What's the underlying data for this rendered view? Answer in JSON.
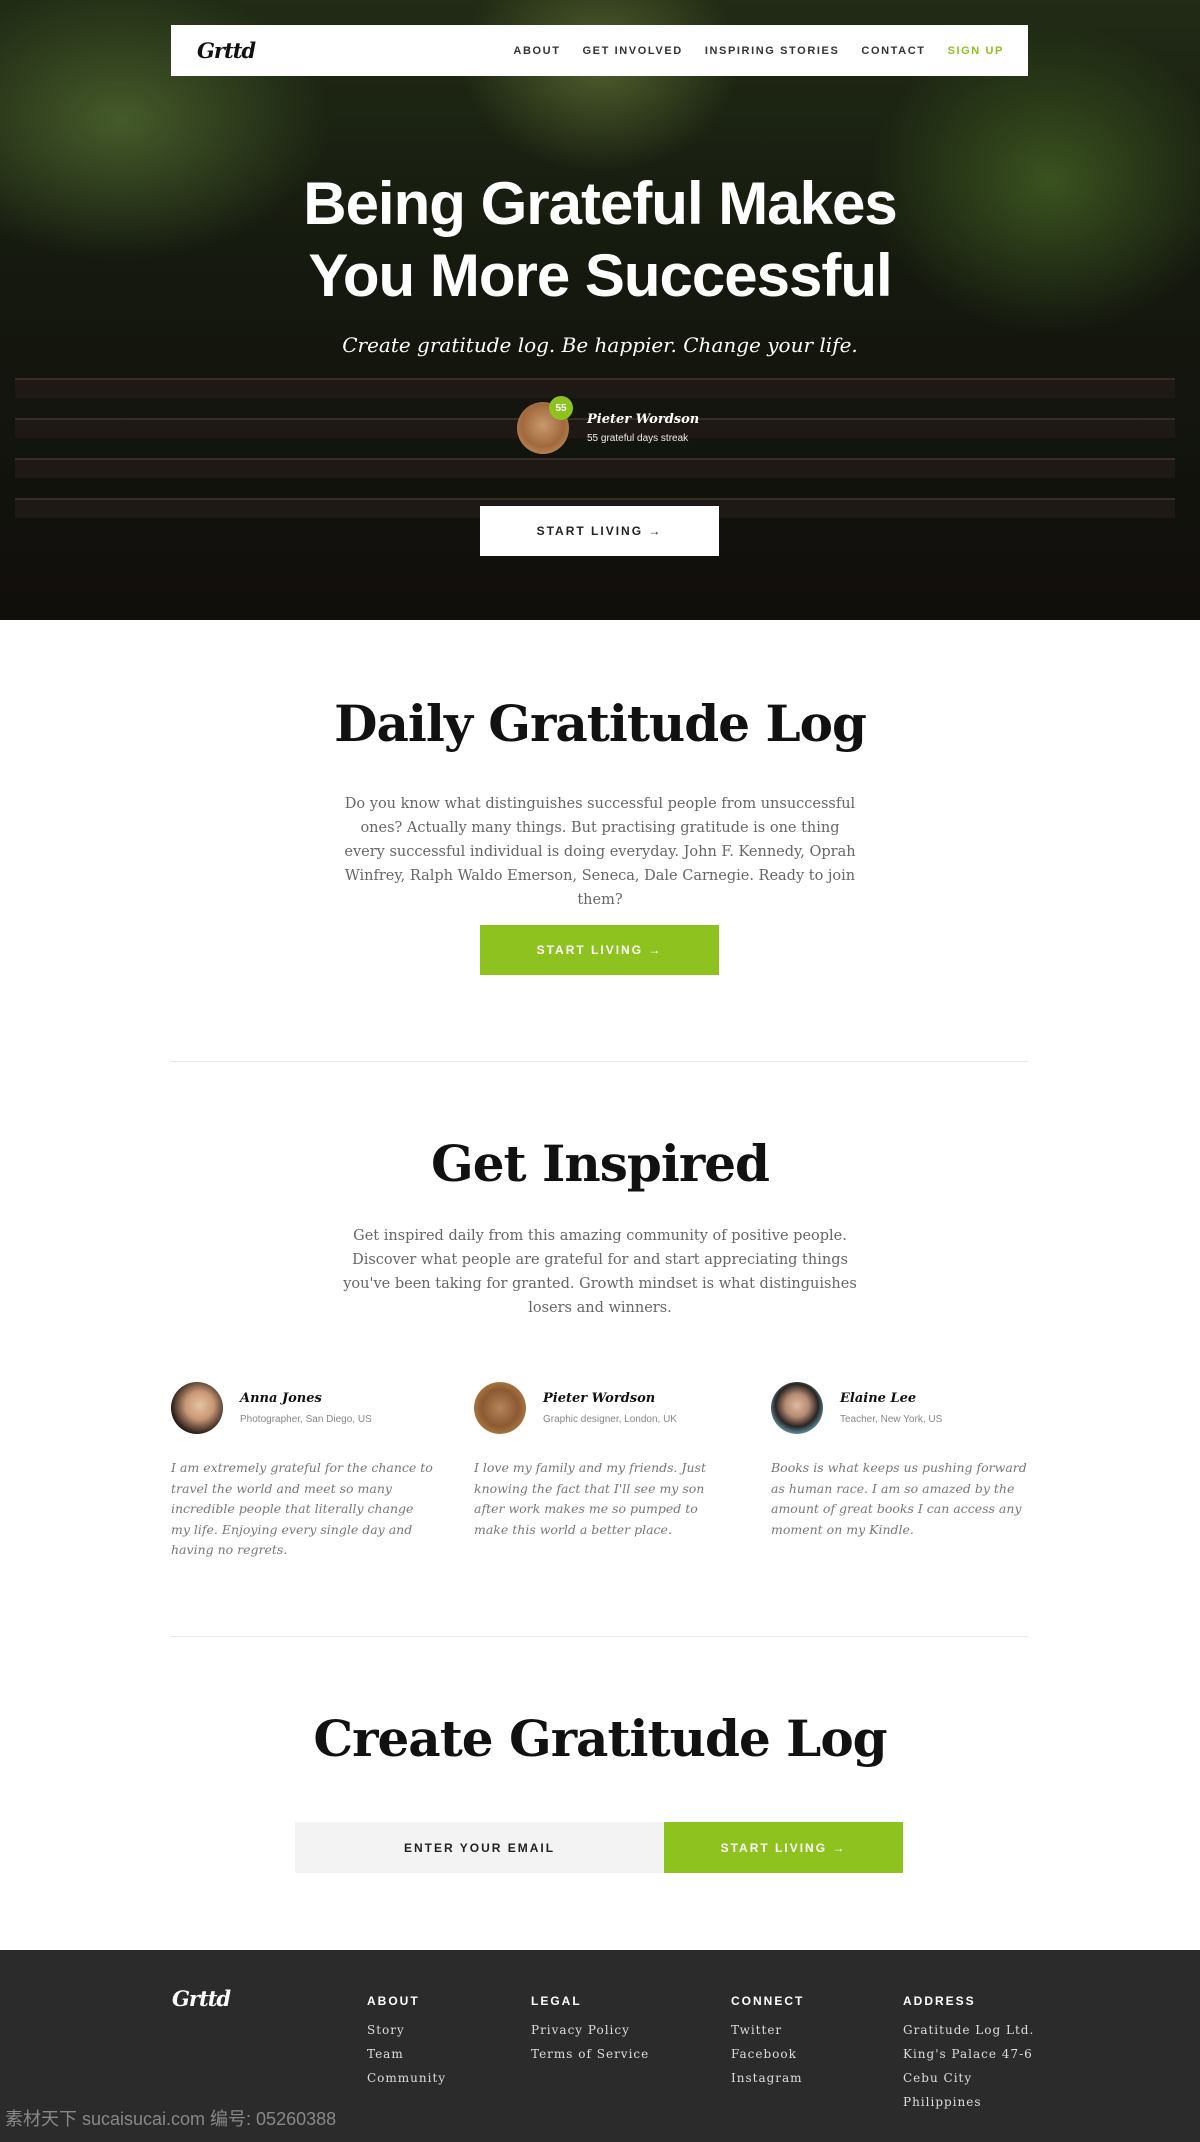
{
  "nav": {
    "logo": "Grttd",
    "links": [
      "ABOUT",
      "GET INVOLVED",
      "INSPIRING STORIES",
      "CONTACT"
    ],
    "signup": "SIGN UP"
  },
  "hero": {
    "title_line1": "Being Grateful Makes",
    "title_line2": "You More Successful",
    "subtitle": "Create gratitude log. Be happier. Change your life.",
    "user": {
      "name": "Pieter Wordson",
      "streak_badge": "55",
      "streak_text": "55 grateful days streak"
    },
    "cta": "START LIVING →"
  },
  "daily": {
    "title": "Daily Gratitude Log",
    "text": "Do you know what distinguishes successful people from unsuccessful ones? Actually many things. But practising gratitude is one thing every successful individual is doing everyday. John F. Kennedy, Oprah Winfrey, Ralph Waldo Emerson, Seneca, Dale Carnegie. Ready to join them?",
    "cta": "START LIVING →"
  },
  "inspired": {
    "title": "Get Inspired",
    "text": "Get inspired daily from this amazing community of positive people. Discover what people are grateful for and start appreciating things you've been taking for granted. Growth mindset is what distinguishes losers and winners.",
    "testimonials": [
      {
        "name": "Anna Jones",
        "role": "Photographer, San Diego, US",
        "quote": "I am extremely grateful for the chance to travel the world and meet so many incredible people that literally change my life. Enjoying every single day and having no regrets."
      },
      {
        "name": "Pieter Wordson",
        "role": "Graphic designer, London, UK",
        "quote": "I love my family and my friends. Just knowing the fact that I'll see my son after work makes me so pumped to make this world a better place."
      },
      {
        "name": "Elaine Lee",
        "role": "Teacher, New York, US",
        "quote": "Books is what keeps us pushing forward as human race. I am so amazed by the amount of great books I can access any moment on my Kindle."
      }
    ]
  },
  "create": {
    "title": "Create Gratitude Log",
    "email_placeholder": "ENTER YOUR EMAIL",
    "cta": "START LIVING →"
  },
  "footer": {
    "logo": "Grttd",
    "columns": [
      {
        "title": "ABOUT",
        "items": [
          "Story",
          "Team",
          "Community"
        ]
      },
      {
        "title": "LEGAL",
        "items": [
          "Privacy Policy",
          "Terms of Service"
        ]
      },
      {
        "title": "CONNECT",
        "items": [
          "Twitter",
          "Facebook",
          "Instagram"
        ]
      },
      {
        "title": "ADDRESS",
        "items": [
          "Gratitude Log Ltd.",
          "King's Palace 47-6",
          "Cebu City",
          "Philippines"
        ]
      }
    ],
    "watermark": "素材天下 sucaisucai.com  编号: 05260388"
  },
  "colors": {
    "accent": "#8dc21f",
    "footer_bg": "#2b2b2b"
  }
}
